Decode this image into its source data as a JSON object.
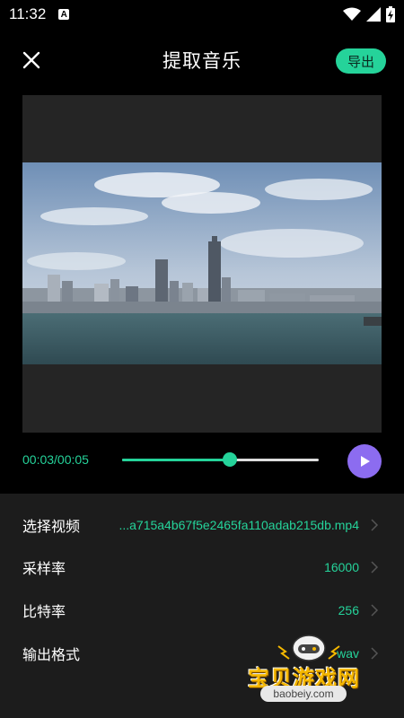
{
  "status_bar": {
    "time": "11:32",
    "notification_icon": "a-letter-icon",
    "wifi_icon": "wifi-icon",
    "signal_icon": "signal-icon",
    "battery_icon": "battery-icon"
  },
  "header": {
    "title": "提取音乐",
    "close_icon": "close-icon",
    "export_label": "导出"
  },
  "player": {
    "time_display": "00:03/00:05",
    "progress": 0.55,
    "play_icon": "play-icon"
  },
  "settings": [
    {
      "label": "选择视频",
      "value": "...a715a4b67f5e2465fa110adab215db.mp4"
    },
    {
      "label": "采样率",
      "value": "16000"
    },
    {
      "label": "比特率",
      "value": "256"
    },
    {
      "label": "输出格式",
      "value": "wav"
    }
  ],
  "watermark": {
    "text": "宝贝游戏网",
    "url": "baobeiy.com"
  },
  "colors": {
    "accent": "#25d39a",
    "play_button": "#8c6cf0",
    "panel": "#1c1c1c",
    "video_bg": "#252525"
  }
}
